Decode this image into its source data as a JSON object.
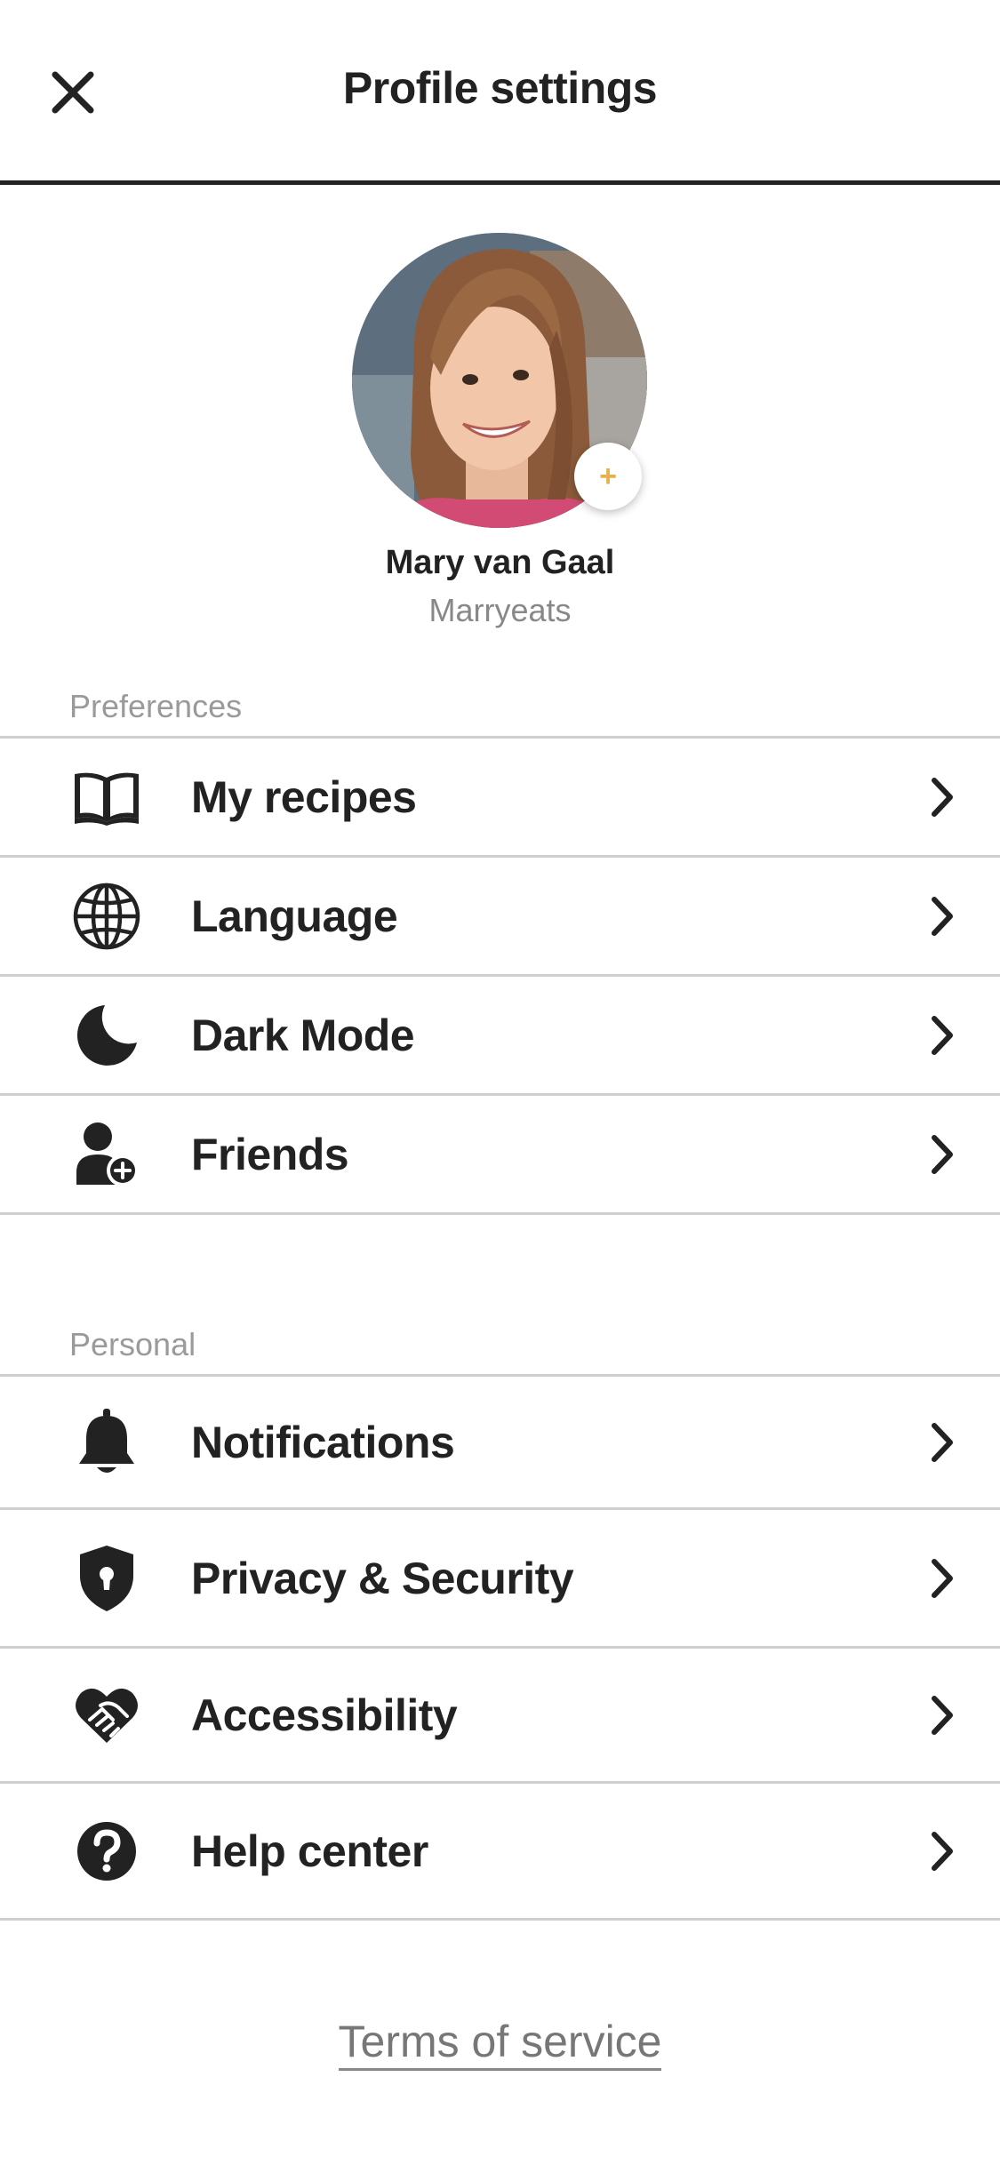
{
  "header": {
    "title": "Profile settings",
    "close_icon": "close-icon"
  },
  "profile": {
    "name": "Mary van Gaal",
    "handle": "Marryeats",
    "add_badge": "+",
    "accent_color": "#E8B04A"
  },
  "preferences": {
    "label": "Preferences",
    "items": [
      {
        "label": "My recipes",
        "icon": "book-open-icon"
      },
      {
        "label": "Language",
        "icon": "globe-icon"
      },
      {
        "label": "Dark Mode",
        "icon": "moon-icon"
      },
      {
        "label": "Friends",
        "icon": "user-plus-icon"
      }
    ]
  },
  "personal": {
    "label": "Personal",
    "items": [
      {
        "label": "Notifications",
        "icon": "bell-icon"
      },
      {
        "label": "Privacy & Security",
        "icon": "shield-lock-icon"
      },
      {
        "label": "Accessibility",
        "icon": "heart-handshake-icon"
      },
      {
        "label": "Help center",
        "icon": "question-circle-icon"
      }
    ]
  },
  "footer": {
    "terms_label": "Terms of service"
  },
  "colors": {
    "text": "#222222",
    "muted": "#888888",
    "divider": "#cfcfcf"
  }
}
